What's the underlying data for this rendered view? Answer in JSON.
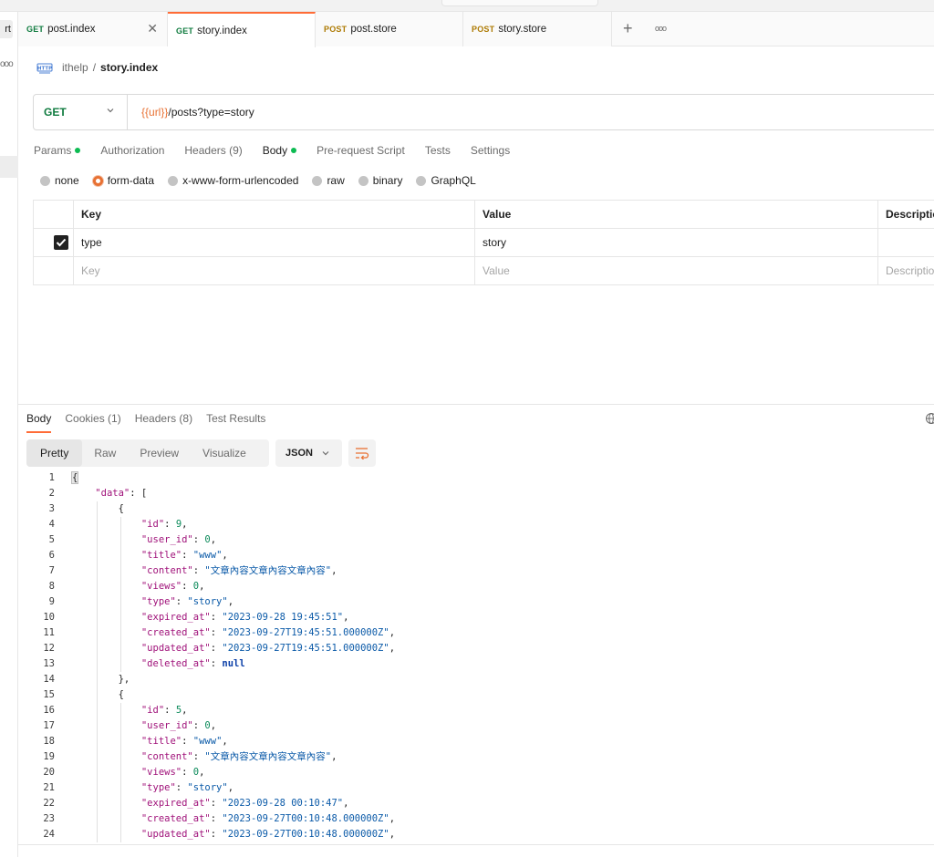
{
  "sidebar": {
    "import_label": "rt",
    "more_label": "ooo"
  },
  "tabs": [
    {
      "method": "GET",
      "name": "post.index",
      "close": "✕"
    },
    {
      "method": "GET",
      "name": "story.index"
    },
    {
      "method": "POST",
      "name": "post.store"
    },
    {
      "method": "POST",
      "name": "story.store"
    }
  ],
  "tab_add": "+",
  "tab_more": "ooo",
  "breadcrumb": {
    "collection": "ithelp",
    "separator": "/",
    "request": "story.index"
  },
  "request": {
    "method": "GET",
    "url_variable": "{{url}}",
    "url_path": "/posts?type=story"
  },
  "request_tabs": [
    {
      "label": "Params",
      "dot": true
    },
    {
      "label": "Authorization",
      "dot": false
    },
    {
      "label": "Headers (9)",
      "dot": false
    },
    {
      "label": "Body",
      "dot": true
    },
    {
      "label": "Pre-request Script",
      "dot": false
    },
    {
      "label": "Tests",
      "dot": false
    },
    {
      "label": "Settings",
      "dot": false
    }
  ],
  "body_types": [
    {
      "label": "none",
      "selected": false
    },
    {
      "label": "form-data",
      "selected": true
    },
    {
      "label": "x-www-form-urlencoded",
      "selected": false
    },
    {
      "label": "raw",
      "selected": false
    },
    {
      "label": "binary",
      "selected": false
    },
    {
      "label": "GraphQL",
      "selected": false
    }
  ],
  "form_table": {
    "headers": {
      "key": "Key",
      "value": "Value",
      "description": "Description"
    },
    "rows": [
      {
        "checked": true,
        "key": "type",
        "value": "story",
        "description": ""
      }
    ],
    "placeholders": {
      "key": "Key",
      "value": "Value",
      "description": "Description"
    }
  },
  "response_tabs": [
    {
      "label": "Body"
    },
    {
      "label": "Cookies (1)"
    },
    {
      "label": "Headers (8)"
    },
    {
      "label": "Test Results"
    }
  ],
  "view_modes": [
    "Pretty",
    "Raw",
    "Preview",
    "Visualize"
  ],
  "format": "JSON",
  "code_lines": [
    "{",
    "    \"data\": [",
    "        {",
    "            \"id\": 9,",
    "            \"user_id\": 0,",
    "            \"title\": \"www\",",
    "            \"content\": \"文章內容文章內容文章內容\",",
    "            \"views\": 0,",
    "            \"type\": \"story\",",
    "            \"expired_at\": \"2023-09-28 19:45:51\",",
    "            \"created_at\": \"2023-09-27T19:45:51.000000Z\",",
    "            \"updated_at\": \"2023-09-27T19:45:51.000000Z\",",
    "            \"deleted_at\": null",
    "        },",
    "        {",
    "            \"id\": 5,",
    "            \"user_id\": 0,",
    "            \"title\": \"www\",",
    "            \"content\": \"文章內容文章內容文章內容\",",
    "            \"views\": 0,",
    "            \"type\": \"story\",",
    "            \"expired_at\": \"2023-09-28 00:10:47\",",
    "            \"created_at\": \"2023-09-27T00:10:48.000000Z\",",
    "            \"updated_at\": \"2023-09-27T00:10:48.000000Z\","
  ],
  "colors": {
    "accent": "#ff6c37",
    "get_method": "#0f7b3f",
    "post_method": "#ad7a03",
    "status_dot": "#0cbb52",
    "json_key": "#a0127a",
    "json_string": "#0b5aa8",
    "json_number": "#0b8a5a"
  },
  "icons": {
    "breadcrumb": "http-request-icon",
    "method_dropdown": "chevron-down-icon",
    "format_dropdown": "chevron-down-icon",
    "wrap": "wrap-lines-icon",
    "globe": "globe-icon"
  }
}
